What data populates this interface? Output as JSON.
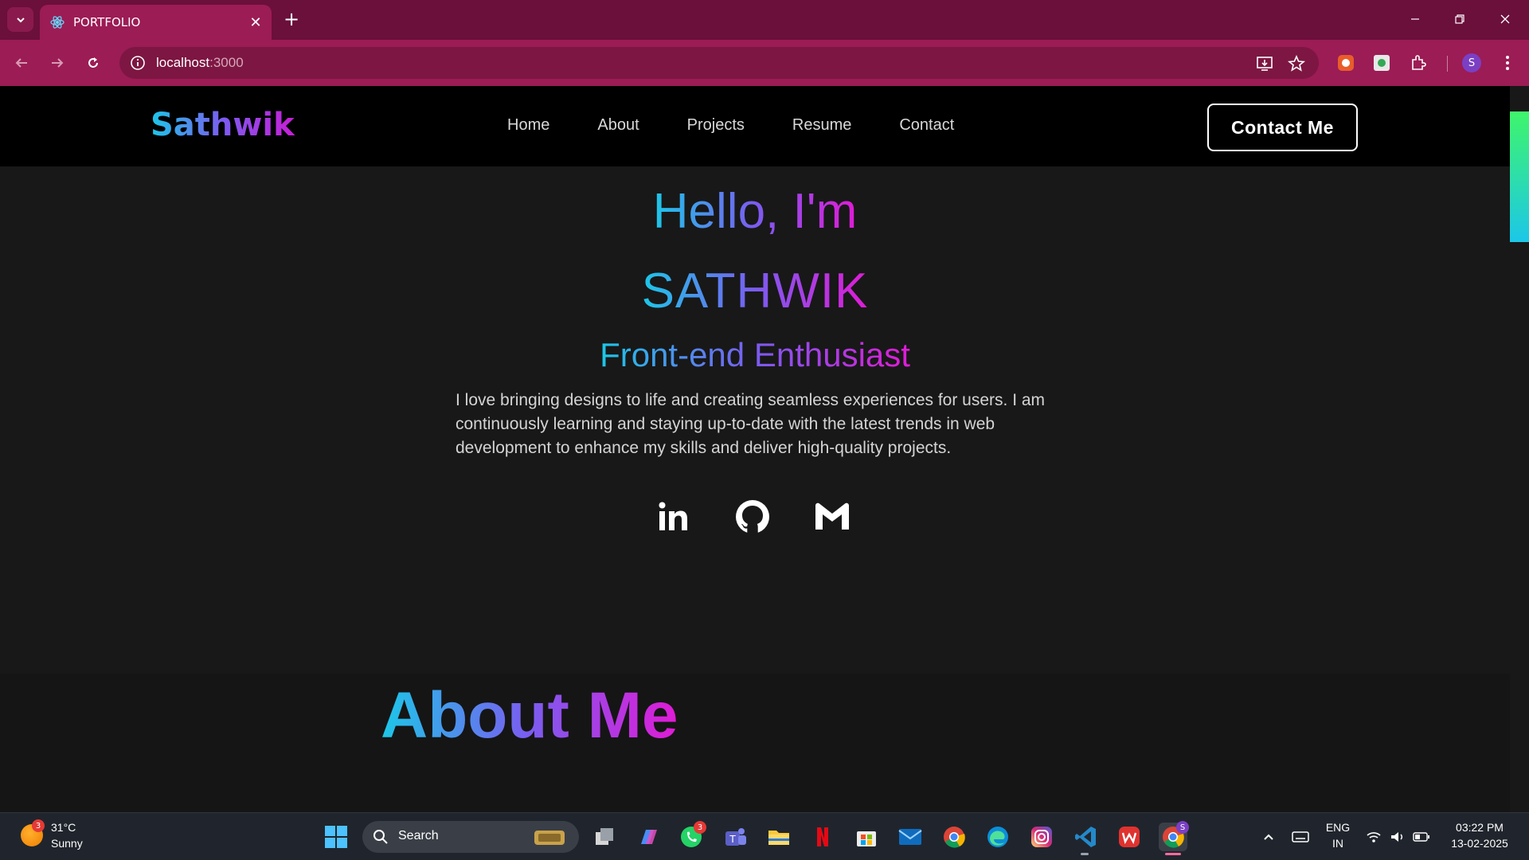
{
  "browser": {
    "tab_title": "PORTFOLIO",
    "url_host": "localhost",
    "url_port": ":3000",
    "profile_initial": "S",
    "accent": "#9c1c55"
  },
  "site": {
    "logo": "Sathwik",
    "nav": [
      "Home",
      "About",
      "Projects",
      "Resume",
      "Contact"
    ],
    "cta": "Contact Me"
  },
  "hero": {
    "greeting": "Hello, I'm",
    "name": "SATHWIK",
    "role": "Front-end Enthusiast",
    "bio": "I love bringing designs to life and creating seamless experiences for users. I am continuously learning and staying up-to-date with the latest trends in web development to enhance my skills and deliver high-quality projects.",
    "socials": [
      "linkedin-icon",
      "github-icon",
      "gmail-icon"
    ],
    "gradient": [
      "#1cc7e8",
      "#7b5cf0",
      "#e01bd6"
    ]
  },
  "about": {
    "title": "About Me"
  },
  "taskbar": {
    "weather_temp": "31°C",
    "weather_desc": "Sunny",
    "weather_badge": "3",
    "search": "Search",
    "whatsapp_badge": "3",
    "lang_line1": "ENG",
    "lang_line2": "IN",
    "time": "03:22 PM",
    "date": "13-02-2025"
  }
}
